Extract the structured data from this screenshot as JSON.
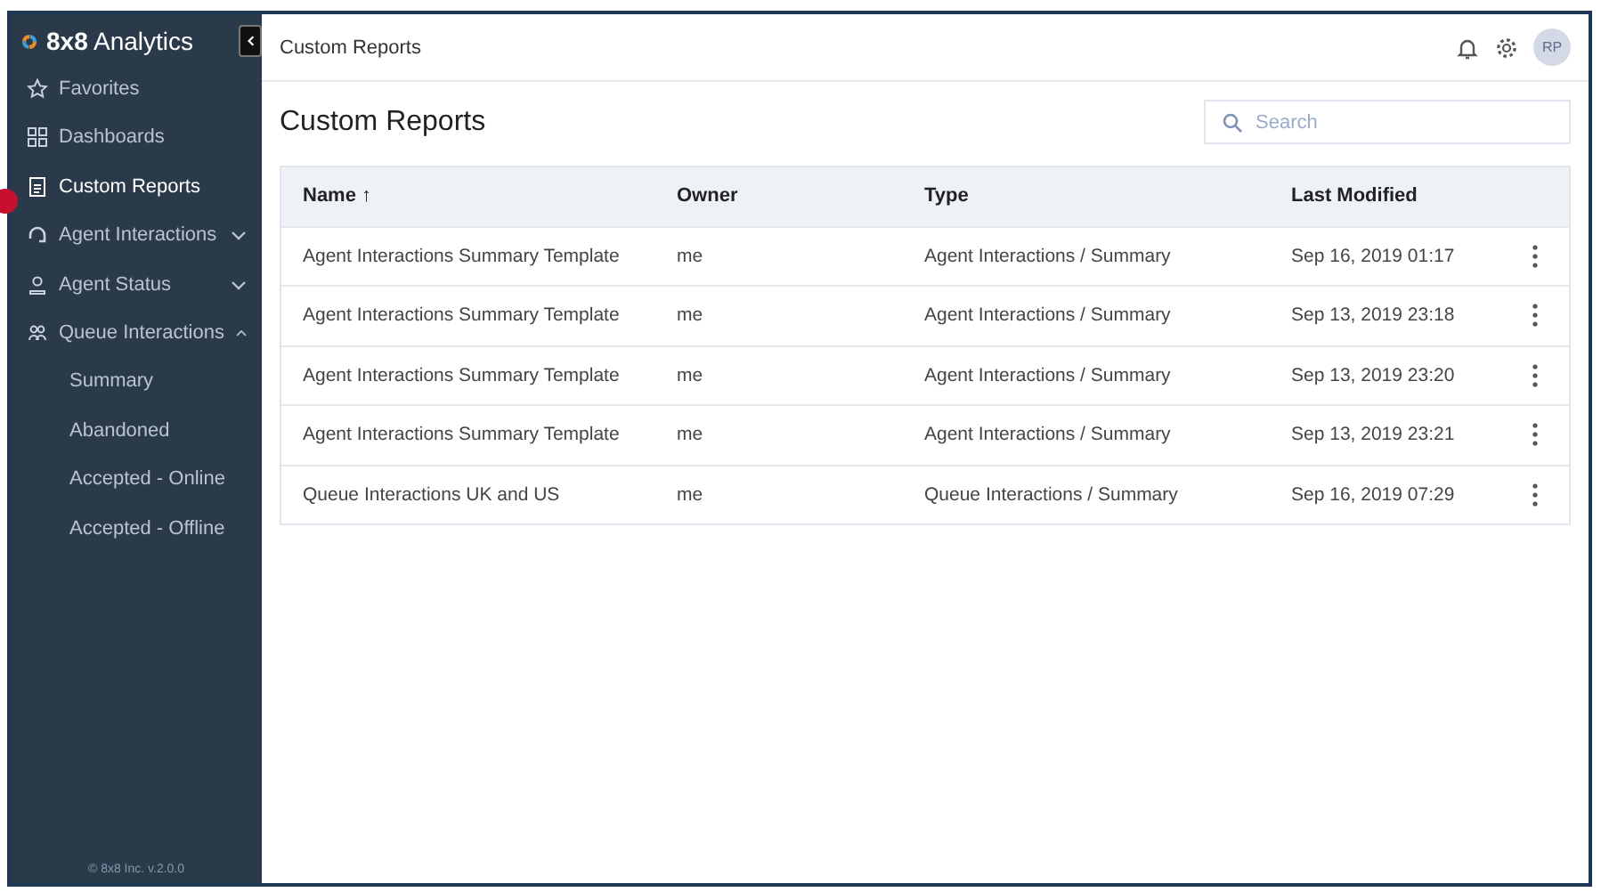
{
  "sidebar": {
    "brand": {
      "bold": "8x8",
      "rest": "Analytics"
    },
    "items": [
      {
        "label": "Favorites",
        "selected": false
      },
      {
        "label": "Dashboards",
        "selected": false
      },
      {
        "label": "Custom Reports",
        "selected": true
      },
      {
        "label": "Agent Interactions",
        "selected": false,
        "expanded": false
      },
      {
        "label": "Agent Status",
        "selected": false,
        "expanded": false
      },
      {
        "label": "Queue Interactions",
        "selected": false,
        "expanded": true,
        "children": [
          {
            "label": "Summary",
            "selected": false
          },
          {
            "label": "Abandoned",
            "selected": false
          },
          {
            "label": "Accepted - Online",
            "selected": false
          },
          {
            "label": "Accepted - Offline",
            "selected": false
          }
        ]
      }
    ],
    "footer": "© 8x8 Inc. v.2.0.0"
  },
  "header": {
    "breadcrumb": "Custom Reports",
    "avatar": "RP"
  },
  "page_title": "Custom Reports",
  "search": {
    "placeholder": "Search"
  },
  "table": {
    "columns": [
      "Name ↑",
      "Owner",
      "Type",
      "Last Modified"
    ],
    "rows": [
      [
        "Agent Interactions Summary Template",
        "me",
        "Agent Interactions / Summary",
        "Sep 16, 2019 01:17"
      ],
      [
        "Agent Interactions Summary Template",
        "me",
        "Agent Interactions / Summary",
        "Sep 13, 2019 23:18"
      ],
      [
        "Agent Interactions Summary Template",
        "me",
        "Agent Interactions / Summary",
        "Sep 13, 2019 23:20"
      ],
      [
        "Agent Interactions Summary Template",
        "me",
        "Agent Interactions / Summary",
        "Sep 13, 2019 23:21"
      ],
      [
        "Queue Interactions UK and US",
        "me",
        "Queue Interactions / Summary",
        "Sep 16, 2019 07:29"
      ]
    ]
  }
}
